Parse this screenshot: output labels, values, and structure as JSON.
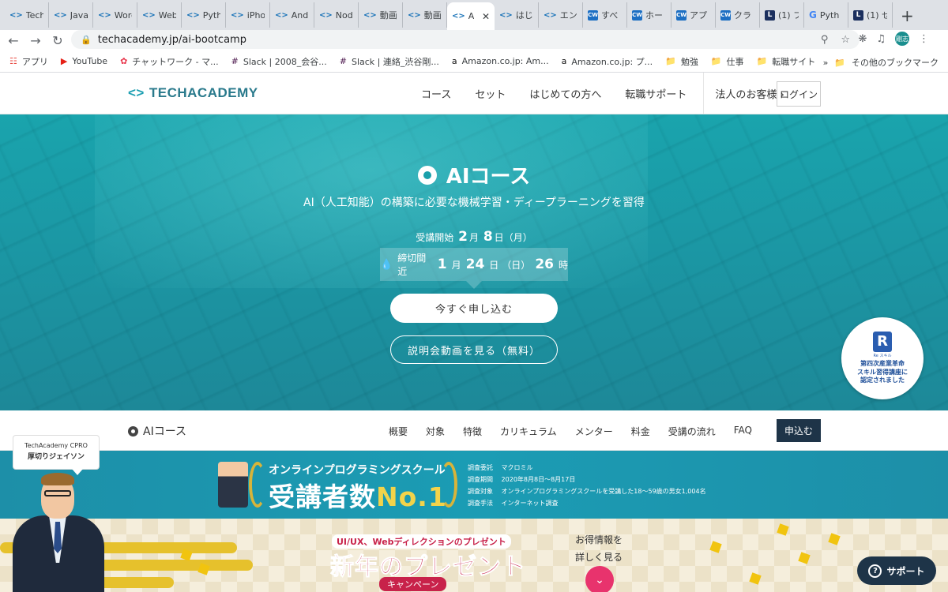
{
  "browser": {
    "tabs": [
      {
        "icon": "<>",
        "title": "Tech"
      },
      {
        "icon": "<>",
        "title": "Java"
      },
      {
        "icon": "<>",
        "title": "Word"
      },
      {
        "icon": "<>",
        "title": "Web"
      },
      {
        "icon": "<>",
        "title": "Pyth"
      },
      {
        "icon": "<>",
        "title": "iPho"
      },
      {
        "icon": "<>",
        "title": "Andr"
      },
      {
        "icon": "<>",
        "title": "Node"
      },
      {
        "icon": "<>",
        "title": "動画"
      },
      {
        "icon": "<>",
        "title": "動画"
      },
      {
        "icon": "<>",
        "title": "A",
        "active": true
      },
      {
        "icon": "<>",
        "title": "はじ"
      },
      {
        "icon": "<>",
        "title": "エン"
      },
      {
        "icon": "CW",
        "title": "すべ"
      },
      {
        "icon": "CW",
        "title": "ホー"
      },
      {
        "icon": "CW",
        "title": "アプ"
      },
      {
        "icon": "CW",
        "title": "クラ"
      },
      {
        "icon": "L",
        "title": "(1) フ"
      },
      {
        "icon": "G",
        "title": "Pyth"
      },
      {
        "icon": "L",
        "title": "(1) せ"
      }
    ],
    "new_tab": "+",
    "url": "techacademy.jp/ai-bootcamp",
    "avatar": "剛志",
    "bookmarks": [
      {
        "icon": "apps-icon",
        "label": "アプリ"
      },
      {
        "icon": "youtube-icon",
        "label": "YouTube"
      },
      {
        "icon": "chatwork-icon",
        "label": "チャットワーク - マ..."
      },
      {
        "icon": "slack-icon",
        "label": "Slack | 2008_会谷..."
      },
      {
        "icon": "slack-icon",
        "label": "Slack | 連絡_渋谷剛..."
      },
      {
        "icon": "amazon-icon",
        "label": "Amazon.co.jp: Am..."
      },
      {
        "icon": "amazon-icon",
        "label": "Amazon.co.jp: プ..."
      },
      {
        "icon": "folder-icon",
        "label": "勉強"
      },
      {
        "icon": "folder-icon",
        "label": "仕事"
      },
      {
        "icon": "folder-icon",
        "label": "転職サイト"
      }
    ],
    "bookmarks_more": "»",
    "other_bookmarks": "その他のブックマーク"
  },
  "header": {
    "logo": "TECHACADEMY",
    "nav": [
      "コース",
      "セット",
      "はじめての方へ",
      "転職サポート"
    ],
    "corporate": "法人のお客様",
    "login": "ログイン"
  },
  "hero": {
    "title": "AIコース",
    "subtitle": "AI（人工知能）の構築に必要な機械学習・ディープラーニングを習得",
    "start_label": "受講開始",
    "start_month": "2",
    "month_unit": "月",
    "start_day": "8",
    "day_unit": "日",
    "start_dow": "（月）",
    "deadline_label": "締切間近",
    "deadline_month": "1",
    "deadline_day": "24",
    "deadline_dow": "（日）",
    "deadline_hour": "26",
    "hour_unit": "時",
    "apply_button": "今すぐ申し込む",
    "video_button": "説明会動画を見る（無料）",
    "badge_small": "Re スキル",
    "badge_text": "第四次産業革命\nスキル習得講座に\n認定されました"
  },
  "subnav": {
    "title": "AIコース",
    "links": [
      "概要",
      "対象",
      "特徴",
      "カリキュラム",
      "メンター",
      "料金",
      "受講の流れ",
      "FAQ"
    ],
    "apply": "申込む"
  },
  "banner_no1": {
    "headline": "オンラインプログラミングスクール",
    "main": "受講者数",
    "rank": "No.1",
    "survey": [
      {
        "key": "調査委託",
        "value": "マクロミル"
      },
      {
        "key": "調査期間",
        "value": "2020年8月8日〜8月17日"
      },
      {
        "key": "調査対象",
        "value": "オンラインプログラミングスクールを受講した18〜59歳の男女1,004名"
      },
      {
        "key": "調査手法",
        "value": "インターネット調査"
      }
    ]
  },
  "banner_newyear": {
    "pre": "UI/UX、Webディレクションのプレゼント",
    "main": "新年のプレゼント",
    "campaign": "キャンペーン",
    "info_line1": "お得情報を",
    "info_line2": "詳しく見る"
  },
  "mascot": {
    "brand": "TechAcademy CPRO",
    "name": "厚切りジェイソン"
  },
  "support": {
    "label": "サポート"
  },
  "colors": {
    "teal": "#1aa4ad",
    "navy": "#1e3448",
    "pink": "#e8336d",
    "crimson": "#c8224a"
  }
}
